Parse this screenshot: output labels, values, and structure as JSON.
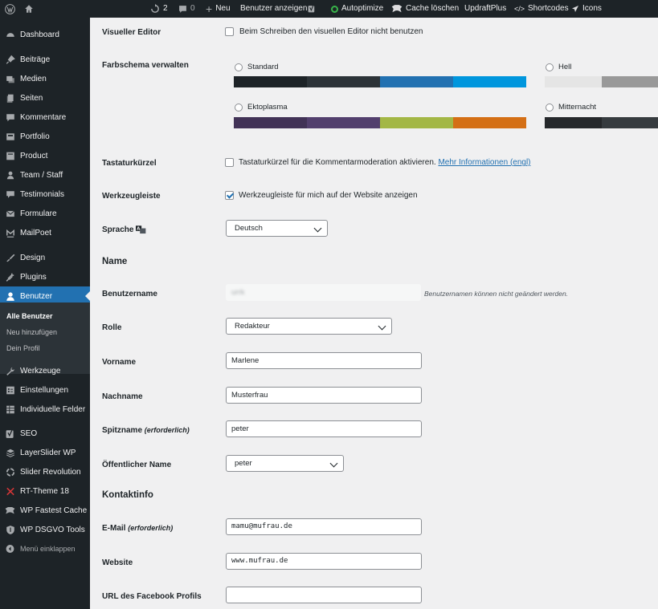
{
  "adminbar": {
    "updates_count": "2",
    "comments_count": "0",
    "new_label": "Neu",
    "view_user_label": "Benutzer anzeigen",
    "autoptimize_label": "Autoptimize",
    "cache_label": "Cache löschen",
    "updraft_label": "UpdraftPlus",
    "shortcodes_label": "Shortcodes",
    "icons_label": "Icons"
  },
  "sidebar": {
    "items": [
      {
        "label": "Dashboard",
        "icon": "dashboard-icon"
      },
      {
        "label": "Beiträge",
        "icon": "pin-icon"
      },
      {
        "label": "Medien",
        "icon": "media-icon"
      },
      {
        "label": "Seiten",
        "icon": "pages-icon"
      },
      {
        "label": "Kommentare",
        "icon": "comments-icon"
      },
      {
        "label": "Portfolio",
        "icon": "portfolio-icon"
      },
      {
        "label": "Product",
        "icon": "product-icon"
      },
      {
        "label": "Team / Staff",
        "icon": "team-icon"
      },
      {
        "label": "Testimonials",
        "icon": "testimonials-icon"
      },
      {
        "label": "Formulare",
        "icon": "mail-icon"
      },
      {
        "label": "MailPoet",
        "icon": "mailpoet-icon"
      },
      {
        "label": "Design",
        "icon": "brush-icon"
      },
      {
        "label": "Plugins",
        "icon": "plugin-icon"
      },
      {
        "label": "Benutzer",
        "icon": "user-icon"
      },
      {
        "label": "Werkzeuge",
        "icon": "wrench-icon"
      },
      {
        "label": "Einstellungen",
        "icon": "settings-icon"
      },
      {
        "label": "Individuelle Felder",
        "icon": "fields-icon"
      },
      {
        "label": "SEO",
        "icon": "yoast-icon"
      },
      {
        "label": "LayerSlider WP",
        "icon": "layers-icon"
      },
      {
        "label": "Slider Revolution",
        "icon": "revolution-icon"
      },
      {
        "label": "RT-Theme 18",
        "icon": "rt-icon"
      },
      {
        "label": "WP Fastest Cache",
        "icon": "cheetah-icon"
      },
      {
        "label": "WP DSGVO Tools",
        "icon": "shield-icon"
      }
    ],
    "submenu": [
      "Alle Benutzer",
      "Neu hinzufügen",
      "Dein Profil"
    ],
    "collapse_label": "Menü einklappen"
  },
  "profile": {
    "visual_editor": {
      "label": "Visueller Editor",
      "checkbox_label": "Beim Schreiben den visuellen Editor nicht benutzen"
    },
    "color_scheme": {
      "label": "Farbschema verwalten",
      "schemes": [
        {
          "name": "Standard",
          "colors": [
            "#1d2327",
            "#2c3338",
            "#2271b1",
            "#0096dd"
          ]
        },
        {
          "name": "Hell",
          "colors": [
            "#e5e5e5",
            "#999999"
          ]
        },
        {
          "name": "Ektoplasma",
          "colors": [
            "#413256",
            "#523f6d",
            "#a3b745",
            "#d46f15"
          ]
        },
        {
          "name": "Mitternacht",
          "colors": [
            "#25282b",
            "#363b3f"
          ]
        }
      ]
    },
    "shortcuts": {
      "label": "Tastaturkürzel",
      "checkbox_label": "Tastaturkürzel für die Kommentarmoderation aktivieren.",
      "link": "Mehr Informationen (engl)"
    },
    "toolbar": {
      "label": "Werkzeugleiste",
      "checkbox_label": "Werkzeugleiste für mich auf der Website anzeigen"
    },
    "language": {
      "label": "Sprache",
      "value": "Deutsch"
    },
    "name_section": "Name",
    "username": {
      "label": "Benutzername",
      "value": "urrk",
      "hint": "Benutzernamen können nicht geändert werden."
    },
    "role": {
      "label": "Rolle",
      "value": "Redakteur"
    },
    "first_name": {
      "label": "Vorname",
      "value": "Marlene"
    },
    "last_name": {
      "label": "Nachname",
      "value": "Musterfrau"
    },
    "nickname": {
      "label": "Spitzname",
      "required": "(erforderlich)",
      "value": "peter"
    },
    "display_name": {
      "label": "Öffentlicher Name",
      "value": "peter"
    },
    "contact_section": "Kontaktinfo",
    "email": {
      "label": "E-Mail",
      "required": "(erforderlich)",
      "value": "mamu@mufrau.de"
    },
    "website": {
      "label": "Website",
      "value": "www.mufrau.de"
    },
    "facebook": {
      "label": "URL des Facebook Profils",
      "value": ""
    }
  },
  "colors": {
    "accent": "#2271b1",
    "sidebar_bg": "#1d2327",
    "autoptimize_green": "#39b54a"
  }
}
